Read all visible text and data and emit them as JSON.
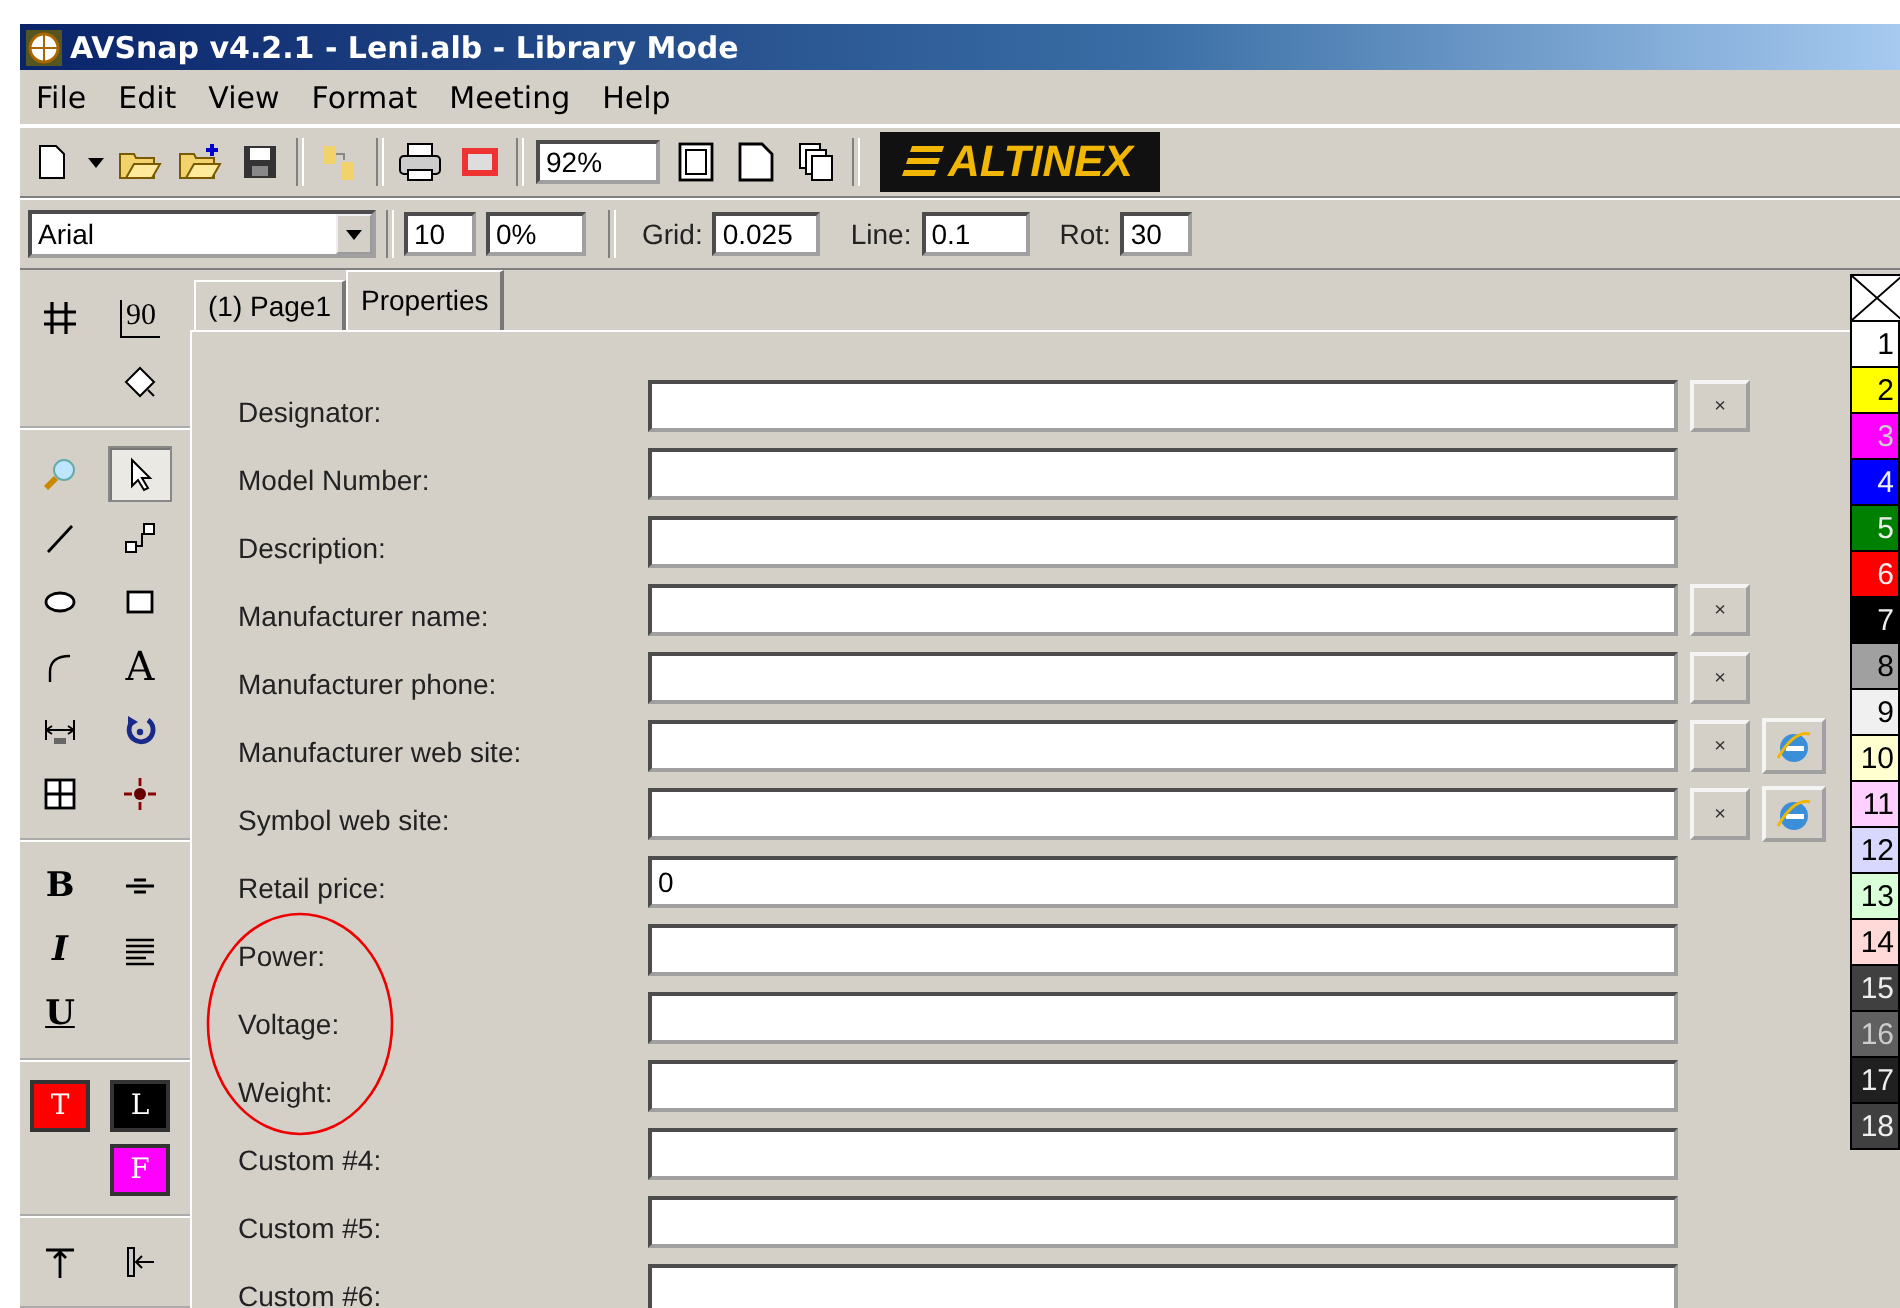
{
  "window": {
    "title": "AVSnap v4.2.1 - Leni.alb  - Library Mode"
  },
  "menu": [
    "File",
    "Edit",
    "View",
    "Format",
    "Meeting",
    "Help"
  ],
  "toolbar": {
    "zoom": "92%",
    "logo": "ALTINEX"
  },
  "format_bar": {
    "font": "Arial",
    "size": "10",
    "percent": "0%",
    "grid_label": "Grid:",
    "grid": "0.025",
    "line_label": "Line:",
    "line": "0.1",
    "rot_label": "Rot:",
    "rot": "30"
  },
  "toolbox": {
    "groups": [
      [
        [
          {
            "kind": "grid",
            "selected": false
          },
          {
            "kind": "angle",
            "label": "90",
            "selected": false
          }
        ],
        [
          {
            "kind": "empty"
          },
          {
            "kind": "diamond",
            "selected": false
          }
        ]
      ],
      [
        [
          {
            "kind": "zoom",
            "selected": false
          },
          {
            "kind": "pointer",
            "selected": true
          }
        ],
        [
          {
            "kind": "line",
            "selected": false
          },
          {
            "kind": "connector",
            "selected": false
          }
        ],
        [
          {
            "kind": "ellipse",
            "selected": false
          },
          {
            "kind": "rect",
            "selected": false
          }
        ],
        [
          {
            "kind": "arc",
            "selected": false
          },
          {
            "kind": "text",
            "label": "A",
            "selected": false
          }
        ],
        [
          {
            "kind": "dimension",
            "selected": false
          },
          {
            "kind": "rotate",
            "selected": false
          }
        ],
        [
          {
            "kind": "table",
            "selected": false
          },
          {
            "kind": "point",
            "selected": false
          }
        ]
      ],
      [
        [
          {
            "kind": "bold",
            "label": "B",
            "selected": false
          },
          {
            "kind": "align-center",
            "selected": false
          }
        ],
        [
          {
            "kind": "italic",
            "label": "I",
            "selected": false
          },
          {
            "kind": "justify",
            "selected": false
          }
        ],
        [
          {
            "kind": "underline",
            "label": "U",
            "selected": false
          },
          {
            "kind": "empty"
          }
        ]
      ],
      [
        [
          {
            "kind": "swatch",
            "label": "T",
            "color": "#ff0000"
          },
          {
            "kind": "swatch",
            "label": "L",
            "color": "#000000"
          }
        ],
        [
          {
            "kind": "empty"
          },
          {
            "kind": "swatch",
            "label": "F",
            "color": "#ff00ff"
          }
        ]
      ],
      [
        [
          {
            "kind": "align-top",
            "selected": false
          },
          {
            "kind": "align-left",
            "selected": false
          }
        ]
      ]
    ]
  },
  "tabs": [
    {
      "label": "(1) Page1",
      "selected": false
    },
    {
      "label": "Properties",
      "selected": true
    }
  ],
  "fields": [
    {
      "label": "Designator:",
      "clear_button": "×",
      "web_button": false,
      "circled": false
    },
    {
      "label": "Model Number:",
      "web_button": false,
      "circled": false
    },
    {
      "label": "Description:",
      "web_button": false,
      "circled": false
    },
    {
      "label": "Manufacturer name:",
      "clear_button": "×",
      "web_button": false,
      "circled": false
    },
    {
      "label": "Manufacturer phone:",
      "clear_button": "×",
      "web_button": false,
      "circled": false
    },
    {
      "label": "Manufacturer web site:",
      "clear_button": "×",
      "web_button": true,
      "circled": false
    },
    {
      "label": "Symbol web site:",
      "clear_button": "×",
      "web_button": true,
      "circled": false
    },
    {
      "label": "Retail price:",
      "value": "0",
      "web_button": false,
      "circled": false
    },
    {
      "label": "Power:",
      "web_button": false,
      "circled": true
    },
    {
      "label": "Voltage:",
      "web_button": false,
      "circled": true
    },
    {
      "label": "Weight:",
      "web_button": false,
      "circled": true
    },
    {
      "label": "Custom #4:",
      "web_button": false,
      "circled": false
    },
    {
      "label": "Custom #5:",
      "web_button": false,
      "circled": false
    },
    {
      "label": "Custom #6:",
      "web_button": false,
      "circled": false
    }
  ],
  "palette": [
    {
      "label": "1",
      "color": "#ffffff"
    },
    {
      "label": "2",
      "color": "#ffff00"
    },
    {
      "label": "3",
      "color": "#ff00ff"
    },
    {
      "label": "4",
      "color": "#0000ff"
    },
    {
      "label": "5",
      "color": "#008000"
    },
    {
      "label": "6",
      "color": "#ff0000"
    },
    {
      "label": "7",
      "color": "#000000"
    },
    {
      "label": "8",
      "color": "#a0a0a0"
    },
    {
      "label": "9",
      "color": "#f0f0f0"
    },
    {
      "label": "10",
      "color": "#ffffd0"
    },
    {
      "label": "11",
      "color": "#ffd0ff"
    },
    {
      "label": "12",
      "color": "#d8d8ff"
    },
    {
      "label": "13",
      "color": "#d8ffd8"
    },
    {
      "label": "14",
      "color": "#ffd8d8"
    },
    {
      "label": "15",
      "color": "#404040"
    },
    {
      "label": "16",
      "color": "#606060"
    },
    {
      "label": "17",
      "color": "#202020"
    },
    {
      "label": "18",
      "color": "#404040"
    }
  ]
}
